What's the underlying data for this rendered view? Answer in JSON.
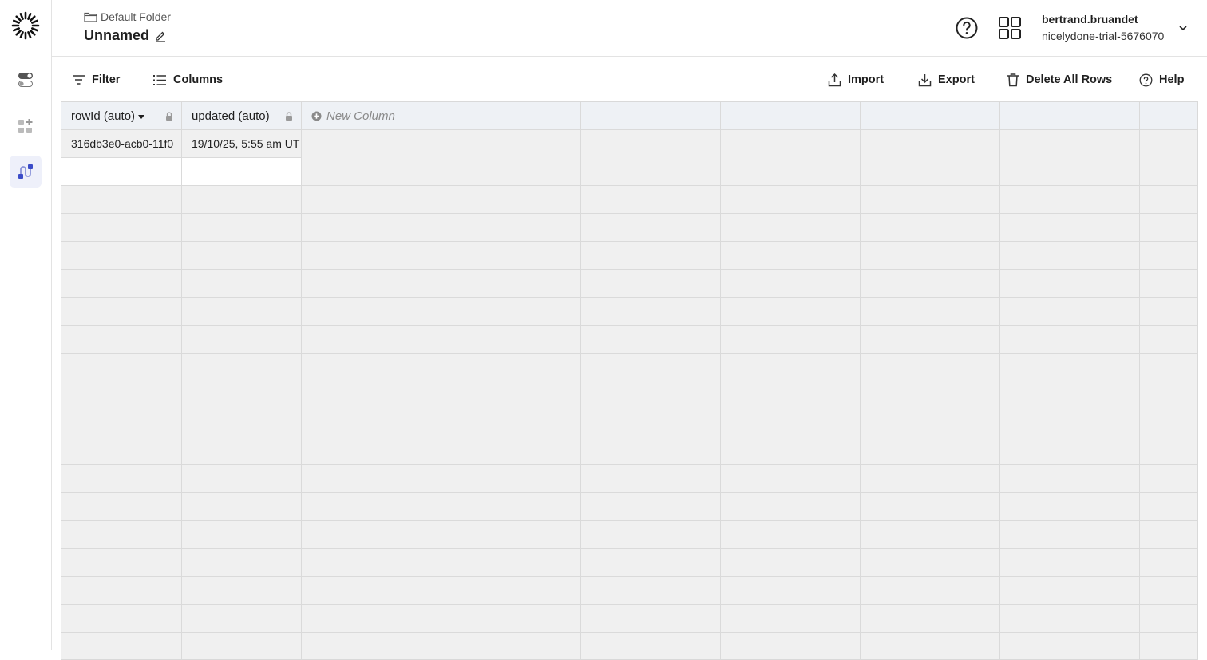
{
  "breadcrumb": {
    "folder": "Default Folder"
  },
  "document": {
    "title": "Unnamed"
  },
  "user": {
    "name": "bertrand.bruandet",
    "org": "nicelydone-trial-5676070"
  },
  "toolbar": {
    "filter": "Filter",
    "columns": "Columns",
    "import": "Import",
    "export": "Export",
    "delete_all": "Delete All Rows",
    "help": "Help"
  },
  "table": {
    "columns": [
      {
        "label": "rowId (auto)",
        "locked": true,
        "sorted": true
      },
      {
        "label": "updated (auto)",
        "locked": true,
        "sorted": false
      }
    ],
    "new_column_label": "New Column",
    "rows": [
      [
        "316db3e0-acb0-11f0",
        "19/10/25, 5:55 am UT"
      ]
    ]
  },
  "colors": {
    "accent": "#3b4cc8",
    "header_bg": "#eef1f5",
    "grid_bg": "#f0f0f0"
  }
}
